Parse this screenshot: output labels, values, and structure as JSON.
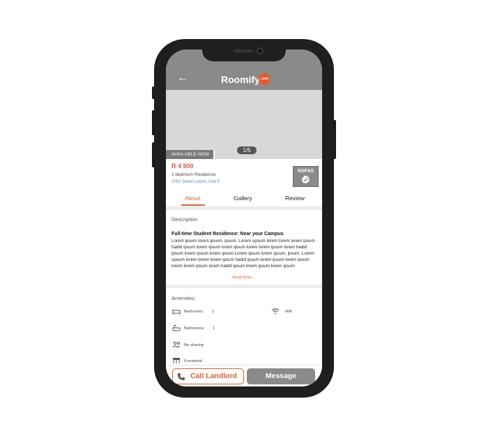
{
  "header": {
    "brand": "Roomify",
    "brand_badge": ".com",
    "back_icon": "arrow-left-icon"
  },
  "listing": {
    "photo_counter": "1/5",
    "availability": "AVAILABLE NOW",
    "price": "R 4 500",
    "type": "1 bedroom Residence",
    "address": "1001 Street Lorem, Unit 5",
    "badge": "NSFAS"
  },
  "tabs": [
    {
      "label": "About",
      "active": true
    },
    {
      "label": "Gallery",
      "active": false
    },
    {
      "label": "Review",
      "active": false
    }
  ],
  "description": {
    "label": "Description",
    "heading": "Full-time Student Residence:  Near your Campus",
    "body": "Lorem ipsum lorem ipsum, ipsum. Lorem upsum lorem lorem lorem ipsum hadid ipsum lorem ipsum lorem ipsum lorem lorem ipsum lorem hadid ipsum lorem ipsum lorem ipsum Lorem ipsum lorem ipsum, ipsum. Lorem upsum lorem lorem lorem ipsum hadid ipsum lorem ipsum lorem ipsum lorem lorem ipsum lorem hadid ipsum lorem ipsum lorem ipsum",
    "read_more": "Read More...."
  },
  "amenities": {
    "label": "Amenities",
    "bedrooms_label": "Bedrooms:",
    "bedrooms_value": "1",
    "wifi_label": "Wifi",
    "bathrooms_label": "Bathrooms:",
    "bathrooms_value": "1",
    "sharing_label": "No sharing",
    "furnished_label": "Furnished"
  },
  "actions": {
    "call_label": "Call Landlord",
    "message_label": "Message"
  },
  "colors": {
    "accent": "#e55b2e",
    "header": "#8a8a8a",
    "link": "#4a7fd8"
  }
}
